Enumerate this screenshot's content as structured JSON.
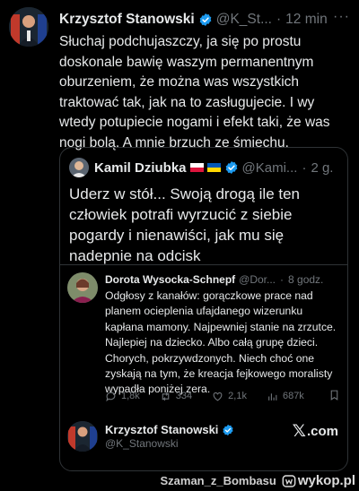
{
  "tweet": {
    "author_name": "Krzysztof Stanowski",
    "author_handle": "@K_St...",
    "separator": "·",
    "time": "12 min",
    "more": "···",
    "text": "Słuchaj podchujaszczy, ja się po prostu doskonale bawię waszym permanentnym oburzeniem, że można was wszystkich traktować tak, jak na to zasługujecie. I wy wtedy potupiecie nogami i efekt taki, że was nogi bolą. A mnie brzuch ze śmiechu."
  },
  "quote": {
    "author_name": "Kamil Dziubka",
    "author_handle": "@Kami...",
    "separator": "·",
    "time": "2 g.",
    "text": "Uderz w stół... Swoją drogą ile ten człowiek potrafi wyrzucić z siebie pogardy i nienawiści, jak mu się nadepnie na odcisk"
  },
  "nested": {
    "author_name": "Dorota Wysocka-Schnepf",
    "author_handle": "@Dor...",
    "separator": "·",
    "time": "8 godz.",
    "text": "Odgłosy z kanałów: gorączkowe prace nad planem ocieplenia ufajdanego wizerunku kapłana mamony. Najpewniej stanie na zrzutce. Najlepiej na dziecko. Albo całą grupę dzieci. Chorych, pokrzywdzonych. Niech choć one zyskają na tym, że kreacja fejkowego moralisty wypadła poniżej zera.",
    "actions": {
      "replies": "1,8k",
      "retweets": "334",
      "likes": "2,1k",
      "views": "687k"
    }
  },
  "card": {
    "author_name": "Krzysztof Stanowski",
    "author_handle": "@K_Stanowski",
    "brand_logo": "𝕏",
    "brand_domain": ".com"
  },
  "watermark": {
    "user": "Szaman_z_Bombasu",
    "site": "wykop.pl"
  },
  "colors": {
    "background": "#000000",
    "text": "#e7e9ea",
    "muted": "#71767b",
    "border": "#2f3336",
    "verified": "#1d9bf0"
  },
  "icons": [
    "verified-badge-icon",
    "more-icon",
    "reply-icon",
    "retweet-icon",
    "like-icon",
    "views-icon",
    "bookmark-icon",
    "x-logo-icon",
    "wykop-logo-icon"
  ]
}
